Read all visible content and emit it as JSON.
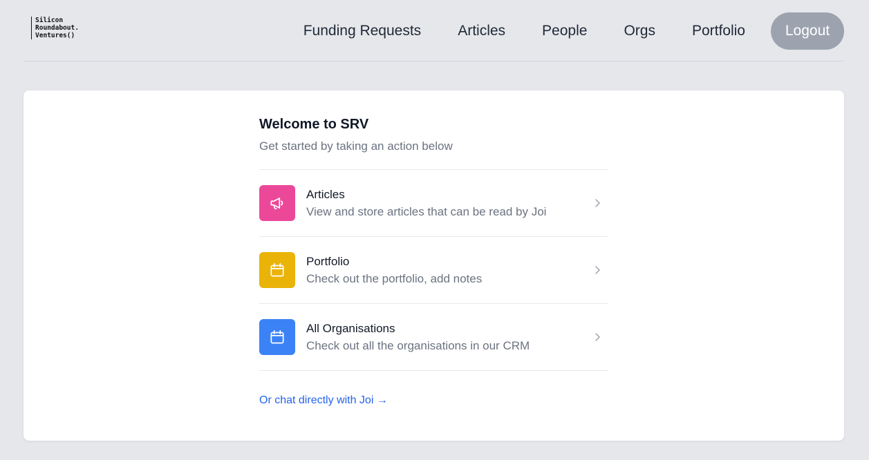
{
  "brand": {
    "logo_lines": [
      "Silicon",
      "Roundabout.",
      "Ventures()"
    ]
  },
  "nav": {
    "links": [
      "Funding Requests",
      "Articles",
      "People",
      "Orgs",
      "Portfolio"
    ],
    "logout_label": "Logout"
  },
  "main": {
    "title": "Welcome to SRV",
    "subtitle": "Get started by taking an action below",
    "actions": [
      {
        "title": "Articles",
        "description": "View and store articles that can be read by Joi",
        "icon": "megaphone-icon",
        "color": "#ec4899"
      },
      {
        "title": "Portfolio",
        "description": "Check out the portfolio, add notes",
        "icon": "calendar-icon",
        "color": "#eab308"
      },
      {
        "title": "All Organisations",
        "description": "Check out all the organisations in our CRM",
        "icon": "calendar-icon",
        "color": "#3b82f6"
      }
    ],
    "chat_link": "Or chat directly with Joi →"
  },
  "colors": {
    "background": "#e6e7eb",
    "card": "#ffffff",
    "link": "#2563eb",
    "logout_bg": "#9ca3af"
  }
}
